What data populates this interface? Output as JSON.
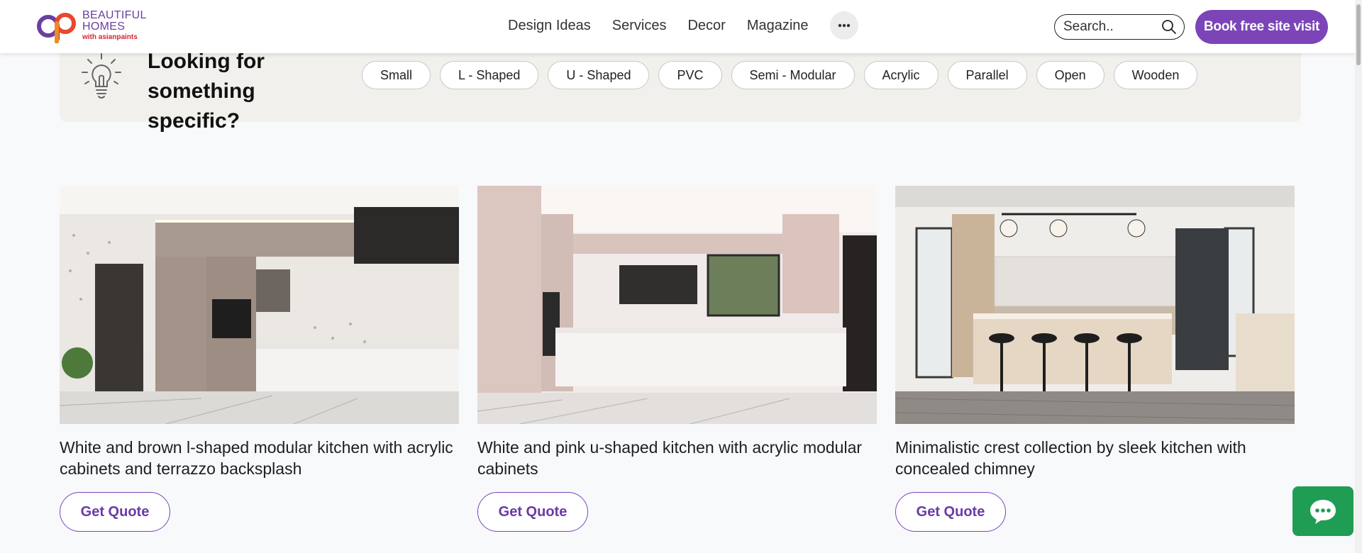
{
  "brand": {
    "line1": "BEAUTIFUL",
    "line2": "HOMES",
    "line3": "with asianpaints",
    "accent": "#7b45b8"
  },
  "nav": {
    "items": [
      "Design Ideas",
      "Services",
      "Decor",
      "Magazine"
    ],
    "more_icon": "ellipsis-icon"
  },
  "search": {
    "placeholder": "Search..",
    "icon": "search-icon"
  },
  "cta": {
    "book_label": "Book free site visit"
  },
  "filter": {
    "title": "Looking for something specific?",
    "icon": "lightbulb-icon",
    "chips": [
      "Small",
      "L - Shaped",
      "U - Shaped",
      "PVC",
      "Semi - Modular",
      "Acrylic",
      "Parallel",
      "Open",
      "Wooden"
    ]
  },
  "cards": [
    {
      "title": "White and brown l-shaped modular kitchen with acrylic cabinets and terrazzo backsplash",
      "button": "Get Quote"
    },
    {
      "title": "White and pink u-shaped kitchen with acrylic modular cabinets",
      "button": "Get Quote"
    },
    {
      "title": "Minimalistic crest collection by sleek kitchen with concealed chimney",
      "button": "Get Quote"
    }
  ],
  "chat": {
    "icon": "chat-bubble-icon"
  }
}
